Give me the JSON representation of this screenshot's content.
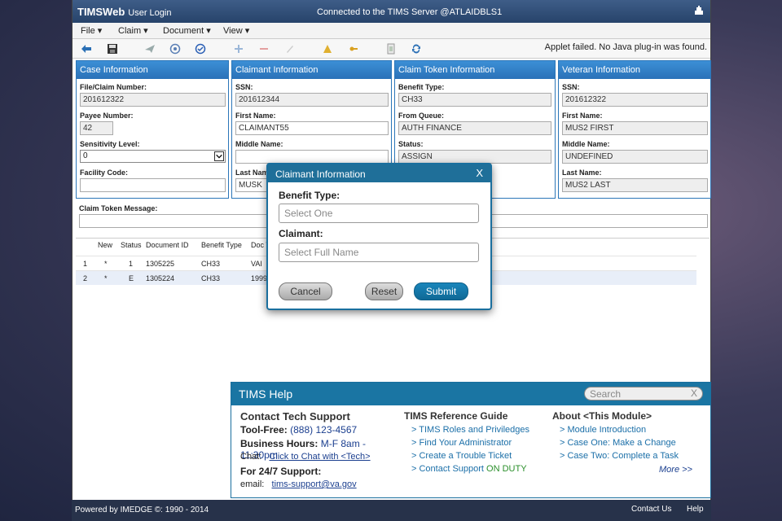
{
  "titlebar": {
    "brand": "TIMSWeb",
    "brand_sub": "User Login",
    "server": "Connected to the TIMS Server @ATLAIDBLS1",
    "icon": "server-icon"
  },
  "menubar": [
    {
      "label": "File ▾"
    },
    {
      "label": "Claim ▾"
    },
    {
      "label": "Document ▾"
    },
    {
      "label": "View ▾"
    }
  ],
  "toolbar": {
    "applet_message": "Applet failed. No Java plug-in was found."
  },
  "case_info": {
    "title": "Case Information",
    "file_claim_label": "File/Claim Number:",
    "file_claim_value": "201612322",
    "payee_label": "Payee Number:",
    "payee_value": "42",
    "sensitivity_label": "Sensitivity Level:",
    "sensitivity_value": "0",
    "facility_label": "Facility Code:",
    "facility_value": ""
  },
  "claimant_info": {
    "title": "Claimant Information",
    "ssn_label": "SSN:",
    "ssn_value": "201612344",
    "first_label": "First Name:",
    "first_value": "CLAIMANT55",
    "middle_label": "Middle Name:",
    "middle_value": "",
    "last_label": "Last Name:",
    "last_value": "MUSK"
  },
  "token_info": {
    "title": "Claim Token Information",
    "benefit_label": "Benefit Type:",
    "benefit_value": "CH33",
    "queue_label": "From Queue:",
    "queue_value": "AUTH FINANCE",
    "status_label": "Status:",
    "status_value": "ASSIGN"
  },
  "veteran_info": {
    "title": "Veteran Information",
    "ssn_label": "SSN:",
    "ssn_value": "201612322",
    "first_label": "First Name:",
    "first_value": "MUS2 FIRST",
    "middle_label": "Middle Name:",
    "middle_value": "UNDEFINED",
    "last_label": "Last Name:",
    "last_value": "MUS2 LAST"
  },
  "claim_token_message": {
    "label": "Claim Token Message:",
    "value": ""
  },
  "grid": {
    "headers": [
      "New",
      "Status",
      "Document ID",
      "Benefit Type",
      "Doc T"
    ],
    "rows": [
      {
        "num": "1",
        "new": "*",
        "status": "1",
        "doc_id": "1305225",
        "benefit": "CH33",
        "doc_type": "VAI"
      },
      {
        "num": "2",
        "new": "*",
        "status": "E",
        "doc_id": "1305224",
        "benefit": "CH33",
        "doc_type": "1999"
      }
    ]
  },
  "modal": {
    "title": "Claimant Information",
    "close": "X",
    "benefit_label": "Benefit Type:",
    "benefit_placeholder": "Select One",
    "claimant_label": "Claimant:",
    "claimant_placeholder": "Select Full Name",
    "cancel": "Cancel",
    "reset": "Reset",
    "submit": "Submit"
  },
  "help": {
    "title": "TIMS Help",
    "search_placeholder": "Search",
    "search_clear": "X",
    "contact": {
      "heading": "Contact Tech Support",
      "tollfree_label": "Tool-Free:",
      "tollfree_value": "(888) 123-4567",
      "hours_label": "Business Hours:",
      "hours_value": "M-F 8am - 11:30pm",
      "chat_label": "Chat:",
      "chat_link": "Click to Chat with <Tech>",
      "support_label": "For 24/7 Support:",
      "email_label": "email:",
      "email_link": "tims-support@va.gov"
    },
    "reference": {
      "heading": "TIMS Reference Guide",
      "links": [
        "> TIMS Roles and Priviledges",
        "> Find Your Administrator",
        "> Create a Trouble Ticket",
        "> Contact Support"
      ],
      "on_duty": "ON DUTY"
    },
    "about": {
      "heading": "About <This Module>",
      "links": [
        "> Module Introduction",
        "> Case One: Make a Change",
        "> Case Two: Complete a Task"
      ],
      "more": "More >>"
    }
  },
  "footer": {
    "powered": "Powered by IMEDGE ©: 1990 - 2014",
    "contact": "Contact Us",
    "help": "Help"
  },
  "colors": {
    "titlebar": "#2f4d78",
    "panel_header": "#2f80c6",
    "modal_header": "#1f6f99",
    "submit": "#1178ab",
    "footer": "#27324a",
    "on_duty": "#2a8f2a"
  }
}
